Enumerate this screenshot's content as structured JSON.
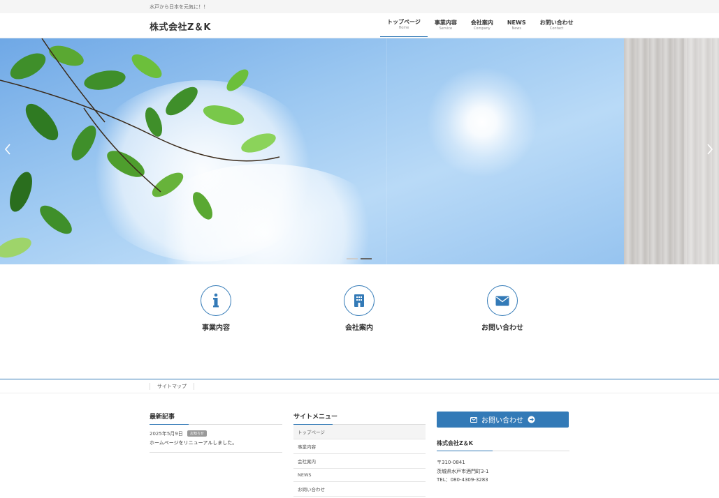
{
  "topbar": {
    "tagline": "水戸から日本を元気に！！"
  },
  "header": {
    "logo": "株式会社Z＆K",
    "nav": [
      {
        "label": "トップページ",
        "sub": "Home",
        "active": true
      },
      {
        "label": "事業内容",
        "sub": "Service"
      },
      {
        "label": "会社案内",
        "sub": "Company"
      },
      {
        "label": "NEWS",
        "sub": "News"
      },
      {
        "label": "お問い合わせ",
        "sub": "Contact"
      }
    ]
  },
  "hero": {
    "prev_icon": "chevron-left-icon",
    "next_icon": "chevron-right-icon",
    "slides": 2,
    "active_slide": 2
  },
  "features": [
    {
      "label": "事業内容",
      "icon": "info-icon"
    },
    {
      "label": "会社案内",
      "icon": "building-icon"
    },
    {
      "label": "お問い合わせ",
      "icon": "envelope-icon"
    }
  ],
  "breadcrumb": {
    "label": "サイトマップ"
  },
  "footer": {
    "latest": {
      "title": "最新記事",
      "posts": [
        {
          "date": "2025年5月9日",
          "badge": "お知らせ",
          "title": "ホームページをリニューアルしました。"
        }
      ]
    },
    "site_menu": {
      "title": "サイトメニュー",
      "items": [
        "トップページ",
        "事業内容",
        "会社案内",
        "NEWS",
        "お問い合わせ"
      ]
    },
    "contact": {
      "button": "お問い合わせ",
      "company": "株式会社Z＆K",
      "postal": "〒310-0841",
      "address": "茨城県水戸市酒門町3-1",
      "tel": "TEL：080-4309-3283"
    }
  },
  "colors": {
    "accent": "#337ab7"
  }
}
